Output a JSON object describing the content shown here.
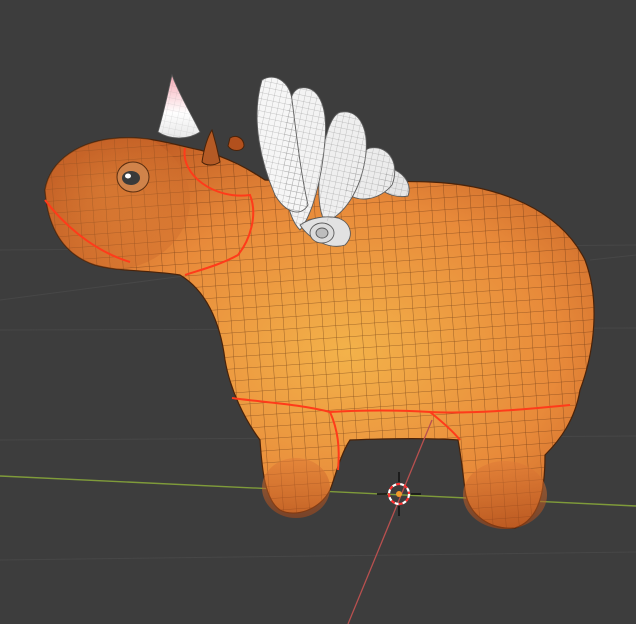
{
  "viewport": {
    "background_color": "#3d3d3d",
    "grid_line_color": "#474747",
    "x_axis_color": "#7f9b3a",
    "y_axis_color": "#b8504f"
  },
  "model": {
    "body_color": "#e07b37",
    "highlight_color": "#f3b24a",
    "shadow_color": "#b7531f",
    "wireframe_color": "#5a2e10",
    "seam_color": "#ff3b1a",
    "wing_color": "#ececec",
    "horn_color": "#f2c4cf"
  },
  "cursor_3d": {
    "ring_colors": [
      "#ff3333",
      "#ffffff"
    ],
    "center_color": "#f39a2a",
    "icon": "3d-cursor-icon"
  }
}
